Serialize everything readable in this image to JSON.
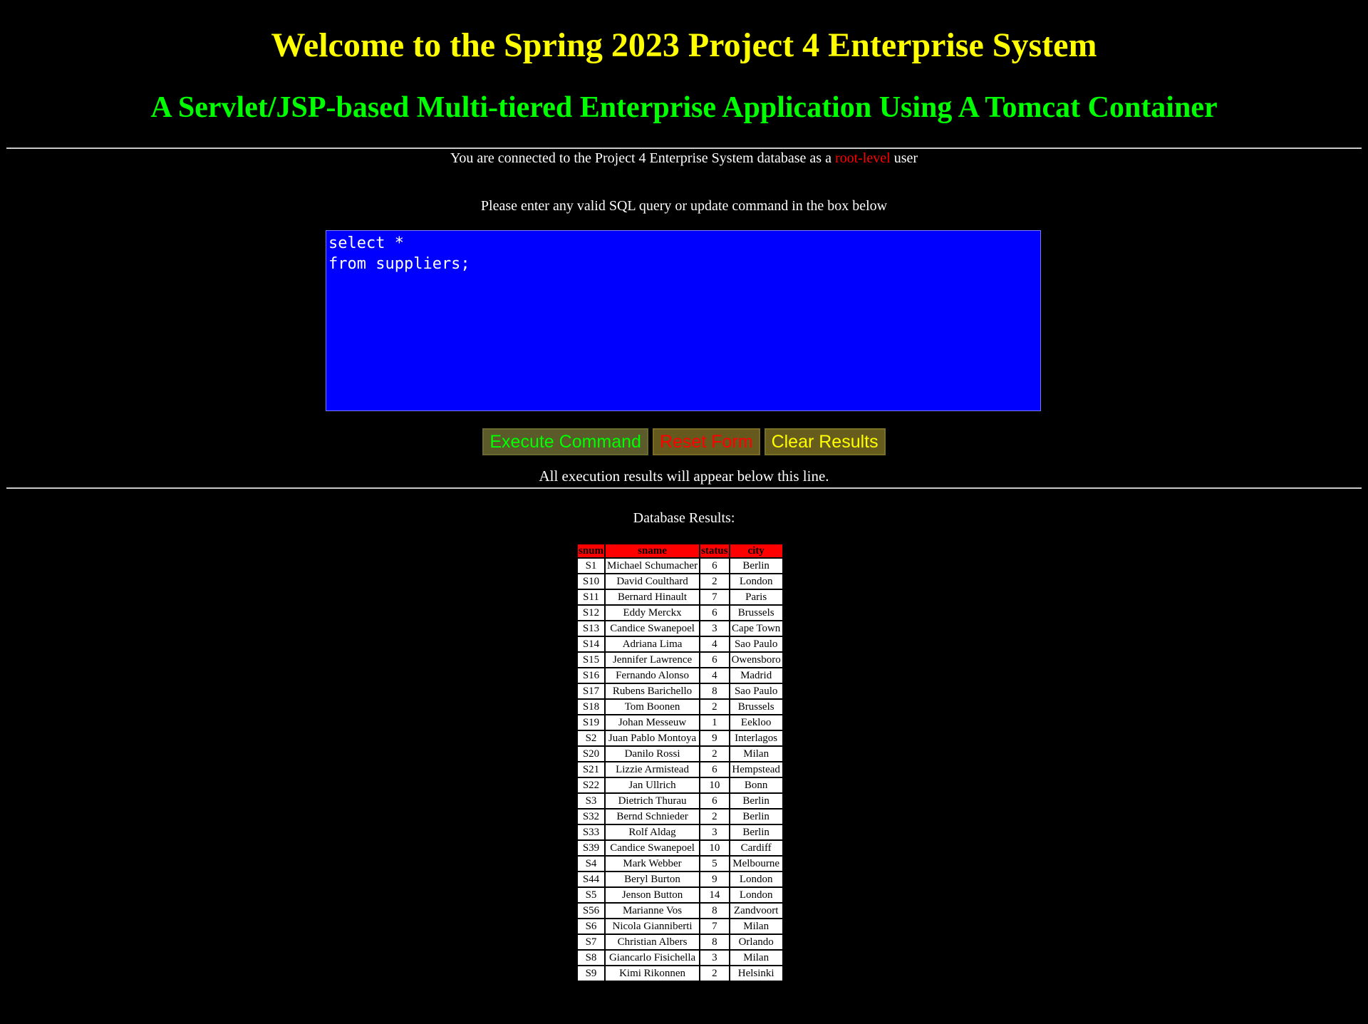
{
  "header": {
    "title": "Welcome to the Spring 2023 Project 4 Enterprise System",
    "subtitle": "A Servlet/JSP-based Multi-tiered Enterprise Application Using A Tomcat Container"
  },
  "connection": {
    "prefix": "You are connected to the Project 4 Enterprise System database as a ",
    "role": "root-level",
    "suffix": " user"
  },
  "colors": {
    "background": "#000000",
    "title": "#ffff00",
    "subtitle": "#00ff00",
    "role": "#ff0000",
    "sql_box": "#0000ff",
    "table_header": "#ff0000"
  },
  "form": {
    "prompt": "Please enter any valid SQL query or update command in the box below",
    "sql_text": "select *\nfrom suppliers;",
    "execute_label": "Execute Command",
    "reset_label": "Reset Form",
    "clear_label": "Clear Results"
  },
  "results": {
    "note": "All execution results will appear below this line.",
    "label": "Database Results:",
    "columns": [
      "snum",
      "sname",
      "status",
      "city"
    ],
    "rows": [
      [
        "S1",
        "Michael Schumacher",
        "6",
        "Berlin"
      ],
      [
        "S10",
        "David Coulthard",
        "2",
        "London"
      ],
      [
        "S11",
        "Bernard Hinault",
        "7",
        "Paris"
      ],
      [
        "S12",
        "Eddy Merckx",
        "6",
        "Brussels"
      ],
      [
        "S13",
        "Candice Swanepoel",
        "3",
        "Cape Town"
      ],
      [
        "S14",
        "Adriana Lima",
        "4",
        "Sao Paulo"
      ],
      [
        "S15",
        "Jennifer Lawrence",
        "6",
        "Owensboro"
      ],
      [
        "S16",
        "Fernando Alonso",
        "4",
        "Madrid"
      ],
      [
        "S17",
        "Rubens Barichello",
        "8",
        "Sao Paulo"
      ],
      [
        "S18",
        "Tom Boonen",
        "2",
        "Brussels"
      ],
      [
        "S19",
        "Johan Messeuw",
        "1",
        "Eekloo"
      ],
      [
        "S2",
        "Juan Pablo Montoya",
        "9",
        "Interlagos"
      ],
      [
        "S20",
        "Danilo Rossi",
        "2",
        "Milan"
      ],
      [
        "S21",
        "Lizzie Armistead",
        "6",
        "Hempstead"
      ],
      [
        "S22",
        "Jan Ullrich",
        "10",
        "Bonn"
      ],
      [
        "S3",
        "Dietrich Thurau",
        "6",
        "Berlin"
      ],
      [
        "S32",
        "Bernd Schnieder",
        "2",
        "Berlin"
      ],
      [
        "S33",
        "Rolf Aldag",
        "3",
        "Berlin"
      ],
      [
        "S39",
        "Candice Swanepoel",
        "10",
        "Cardiff"
      ],
      [
        "S4",
        "Mark Webber",
        "5",
        "Melbourne"
      ],
      [
        "S44",
        "Beryl Burton",
        "9",
        "London"
      ],
      [
        "S5",
        "Jenson Button",
        "14",
        "London"
      ],
      [
        "S56",
        "Marianne Vos",
        "8",
        "Zandvoort"
      ],
      [
        "S6",
        "Nicola Gianniberti",
        "7",
        "Milan"
      ],
      [
        "S7",
        "Christian Albers",
        "8",
        "Orlando"
      ],
      [
        "S8",
        "Giancarlo Fisichella",
        "3",
        "Milan"
      ],
      [
        "S9",
        "Kimi Rikonnen",
        "2",
        "Helsinki"
      ]
    ]
  }
}
